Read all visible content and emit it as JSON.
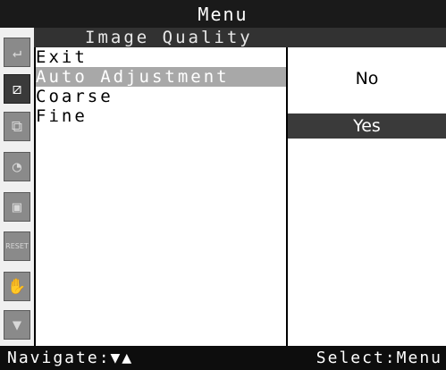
{
  "title": "Menu",
  "subtitle": "Image Quality",
  "side_icons": [
    {
      "name": "return-icon",
      "glyph": "↵"
    },
    {
      "name": "auto-adjust-icon",
      "glyph": "⧄"
    },
    {
      "name": "position-icon",
      "glyph": "⧉"
    },
    {
      "name": "color-palette-icon",
      "glyph": "◔"
    },
    {
      "name": "size-icon",
      "glyph": "▣"
    },
    {
      "name": "reset-icon",
      "glyph": "RESET"
    },
    {
      "name": "hand-icon",
      "glyph": "✋"
    },
    {
      "name": "scroll-down-icon",
      "glyph": "▼"
    }
  ],
  "menu_items": [
    "Exit",
    "Auto Adjustment",
    "Coarse",
    "Fine"
  ],
  "selected_menu_index": 1,
  "options": [
    "No",
    "Yes"
  ],
  "selected_option_index": 1,
  "footer": {
    "left": "Navigate:▼▲",
    "right": "Select:Menu"
  },
  "colors": {
    "title_bg": "#1a1a1a",
    "highlight": "#a8a8a8",
    "selected_option": "#3a3a3a"
  }
}
